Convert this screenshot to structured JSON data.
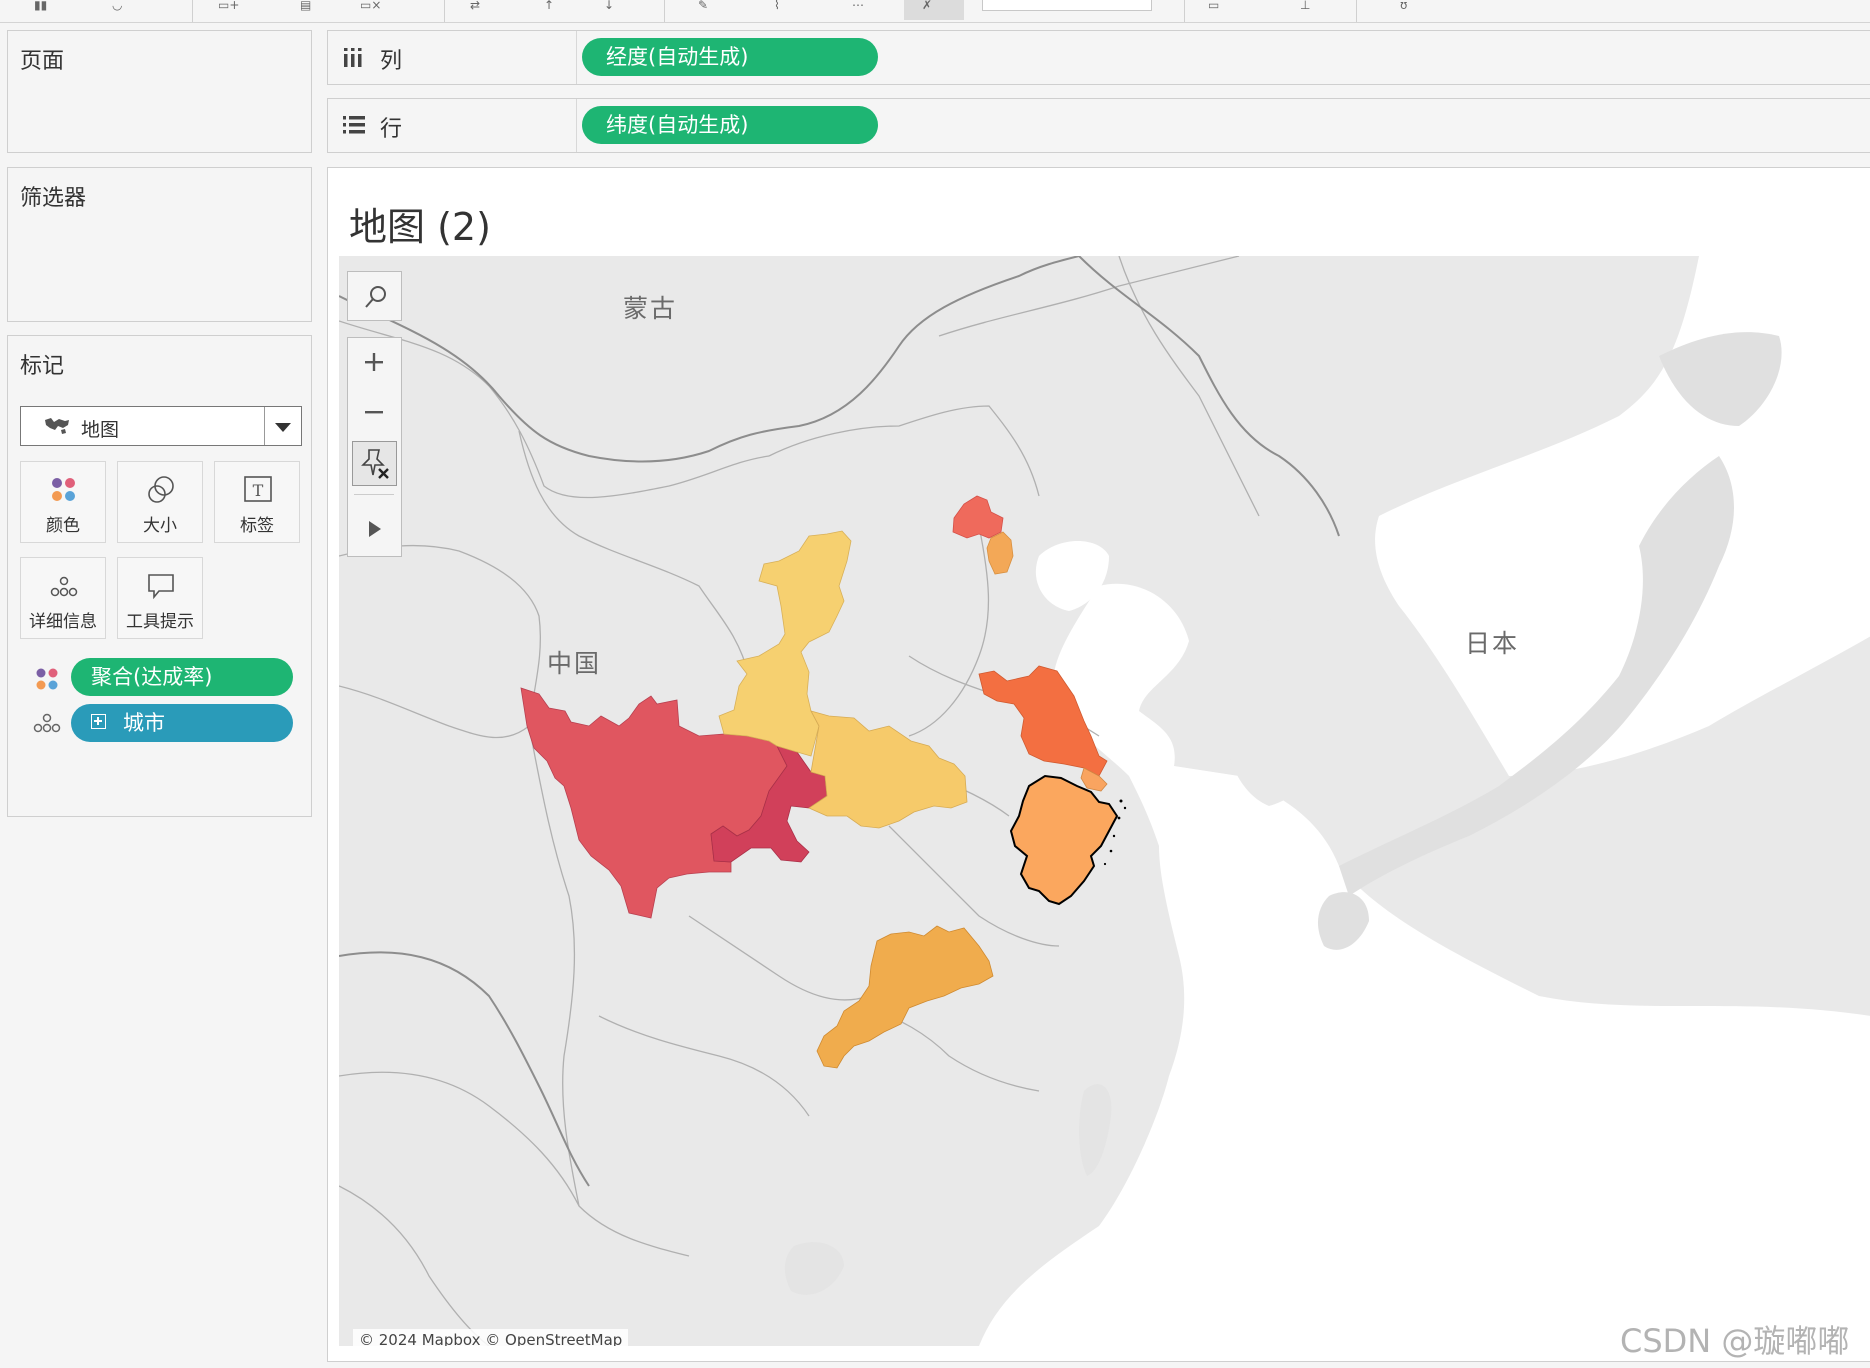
{
  "shelves": {
    "columns": {
      "label": "列",
      "pill": "经度(自动生成)"
    },
    "rows": {
      "label": "行",
      "pill": "纬度(自动生成)"
    }
  },
  "cards": {
    "pages": {
      "title": "页面"
    },
    "filters": {
      "title": "筛选器"
    },
    "marks": {
      "title": "标记",
      "mark_type": "地图",
      "buttons": {
        "color": "颜色",
        "size": "大小",
        "label": "标签",
        "detail": "详细信息",
        "tooltip": "工具提示"
      },
      "fields": {
        "color_field": "聚合(达成率)",
        "detail_field": "城市"
      }
    }
  },
  "view": {
    "title": "地图 (2)",
    "map_labels": {
      "mongolia": "蒙古",
      "china": "中国",
      "japan": "日本"
    },
    "attribution": "© 2024 Mapbox © OpenStreetMap"
  },
  "watermark": "CSDN @璇嘟嘟",
  "colors": {
    "green_pill": "#1eb573",
    "teal_pill": "#2a9bb9",
    "sichuan": "#e05660",
    "chongqing": "#d1405a",
    "shaanxi": "#f6d070",
    "hubei": "#f6ca6a",
    "beijing": "#ef6a5c",
    "tianjin": "#f3a857",
    "jiangsu": "#f36f41",
    "zhejiang": "#fba75e",
    "shanghai": "#f9a460",
    "guangdong": "#f0ac4d"
  },
  "highlighted_provinces": [
    "四川",
    "重庆",
    "陕西",
    "湖北",
    "北京",
    "天津",
    "江苏",
    "上海",
    "浙江",
    "广东"
  ]
}
